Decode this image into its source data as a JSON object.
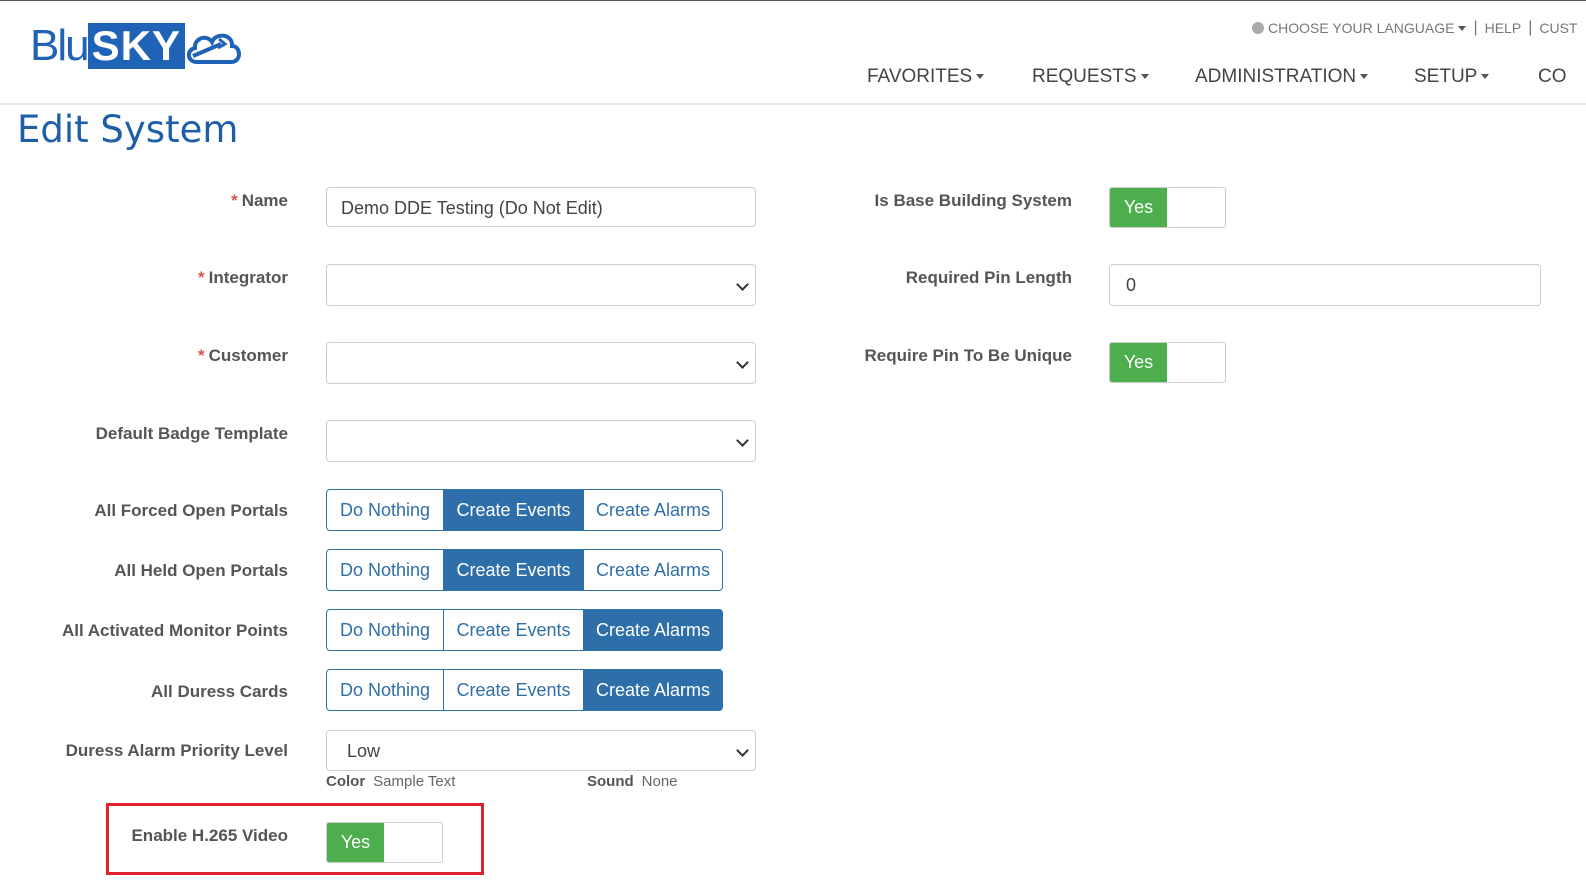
{
  "header": {
    "logo_text_1": "Blu",
    "logo_text_2": "SKY",
    "language_label": "CHOOSE YOUR LANGUAGE",
    "help_label": "HELP",
    "cust_label": "CUST",
    "nav": [
      "FAVORITES",
      "REQUESTS",
      "ADMINISTRATION",
      "SETUP",
      "CO"
    ]
  },
  "page": {
    "title": "Edit System"
  },
  "form": {
    "name_label": "Name",
    "name_value": "Demo DDE Testing (Do Not Edit)",
    "integrator_label": "Integrator",
    "integrator_value": "",
    "customer_label": "Customer",
    "customer_value": "",
    "badge_label": "Default Badge Template",
    "badge_value": "",
    "option_labels": [
      "Do Nothing",
      "Create Events",
      "Create Alarms"
    ],
    "forced_open_label": "All Forced Open Portals",
    "held_open_label": "All Held Open Portals",
    "monitor_points_label": "All Activated Monitor Points",
    "duress_cards_label": "All Duress Cards",
    "duress_priority_label": "Duress Alarm Priority Level",
    "duress_priority_value": "Low",
    "color_label": "Color",
    "color_value": "Sample Text",
    "sound_label": "Sound",
    "sound_value": "None",
    "h265_label": "Enable H.265 Video",
    "h265_value": "Yes",
    "base_building_label": "Is Base Building System",
    "base_building_value": "Yes",
    "pin_length_label": "Required Pin Length",
    "pin_length_value": "0",
    "pin_unique_label": "Require Pin To Be Unique",
    "pin_unique_value": "Yes"
  },
  "selected": {
    "forced_open": "Create Events",
    "held_open": "Create Events",
    "monitor_points": "Create Alarms",
    "duress_cards": "Create Alarms"
  },
  "colors": {
    "brand": "#1f63b6",
    "accent": "#2f6fa9",
    "toggle_on": "#4cae4c",
    "required": "#d9534f",
    "highlight": "#e0202c"
  }
}
